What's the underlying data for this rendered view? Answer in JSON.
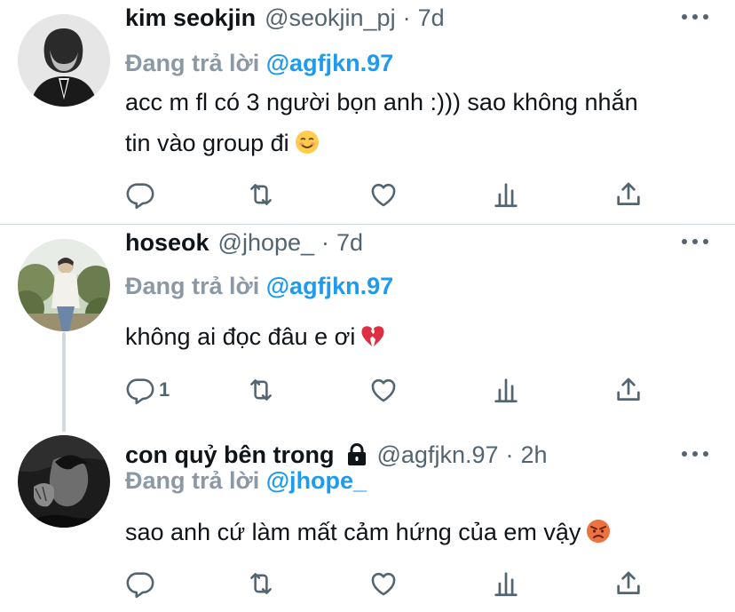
{
  "tweets": [
    {
      "name": "kim seokjin",
      "handle": "@seokjin_pj",
      "separator": "·",
      "time": "7d",
      "replying_prefix": "Đang trả lời",
      "replying_to": "@agfjkn.97",
      "text_line1": "acc m fl có 3 người bọn anh :))) sao không nhắn",
      "text_line2": "tin vào group đi",
      "emoji": "smiling-face-icon",
      "reply_count": ""
    },
    {
      "name": "hoseok",
      "handle": "@jhope_",
      "separator": "·",
      "time": "7d",
      "replying_prefix": "Đang trả lời",
      "replying_to": "@agfjkn.97",
      "text_line1": "không ai đọc đâu e ơi",
      "emoji": "broken-heart-icon",
      "reply_count": "1"
    },
    {
      "name": "con quỷ bên trong",
      "locked": true,
      "handle": "@agfjkn.97",
      "separator": "·",
      "time": "2h",
      "replying_prefix": "Đang trả lời",
      "replying_to": "@jhope_",
      "text_line1": "sao anh cứ làm mất cảm hứng của em vậy",
      "emoji": "angry-face-icon",
      "reply_count": ""
    }
  ],
  "icons": {
    "reply": "reply-icon",
    "retweet": "retweet-icon",
    "like": "like-icon",
    "views": "views-icon",
    "share": "share-icon",
    "more": "more-icon",
    "lock": "lock-icon"
  },
  "colors": {
    "mention": "#1d9bf0",
    "replying_prefix": "#8b98a5",
    "secondary": "#536471",
    "divider": "#cfd9de"
  }
}
